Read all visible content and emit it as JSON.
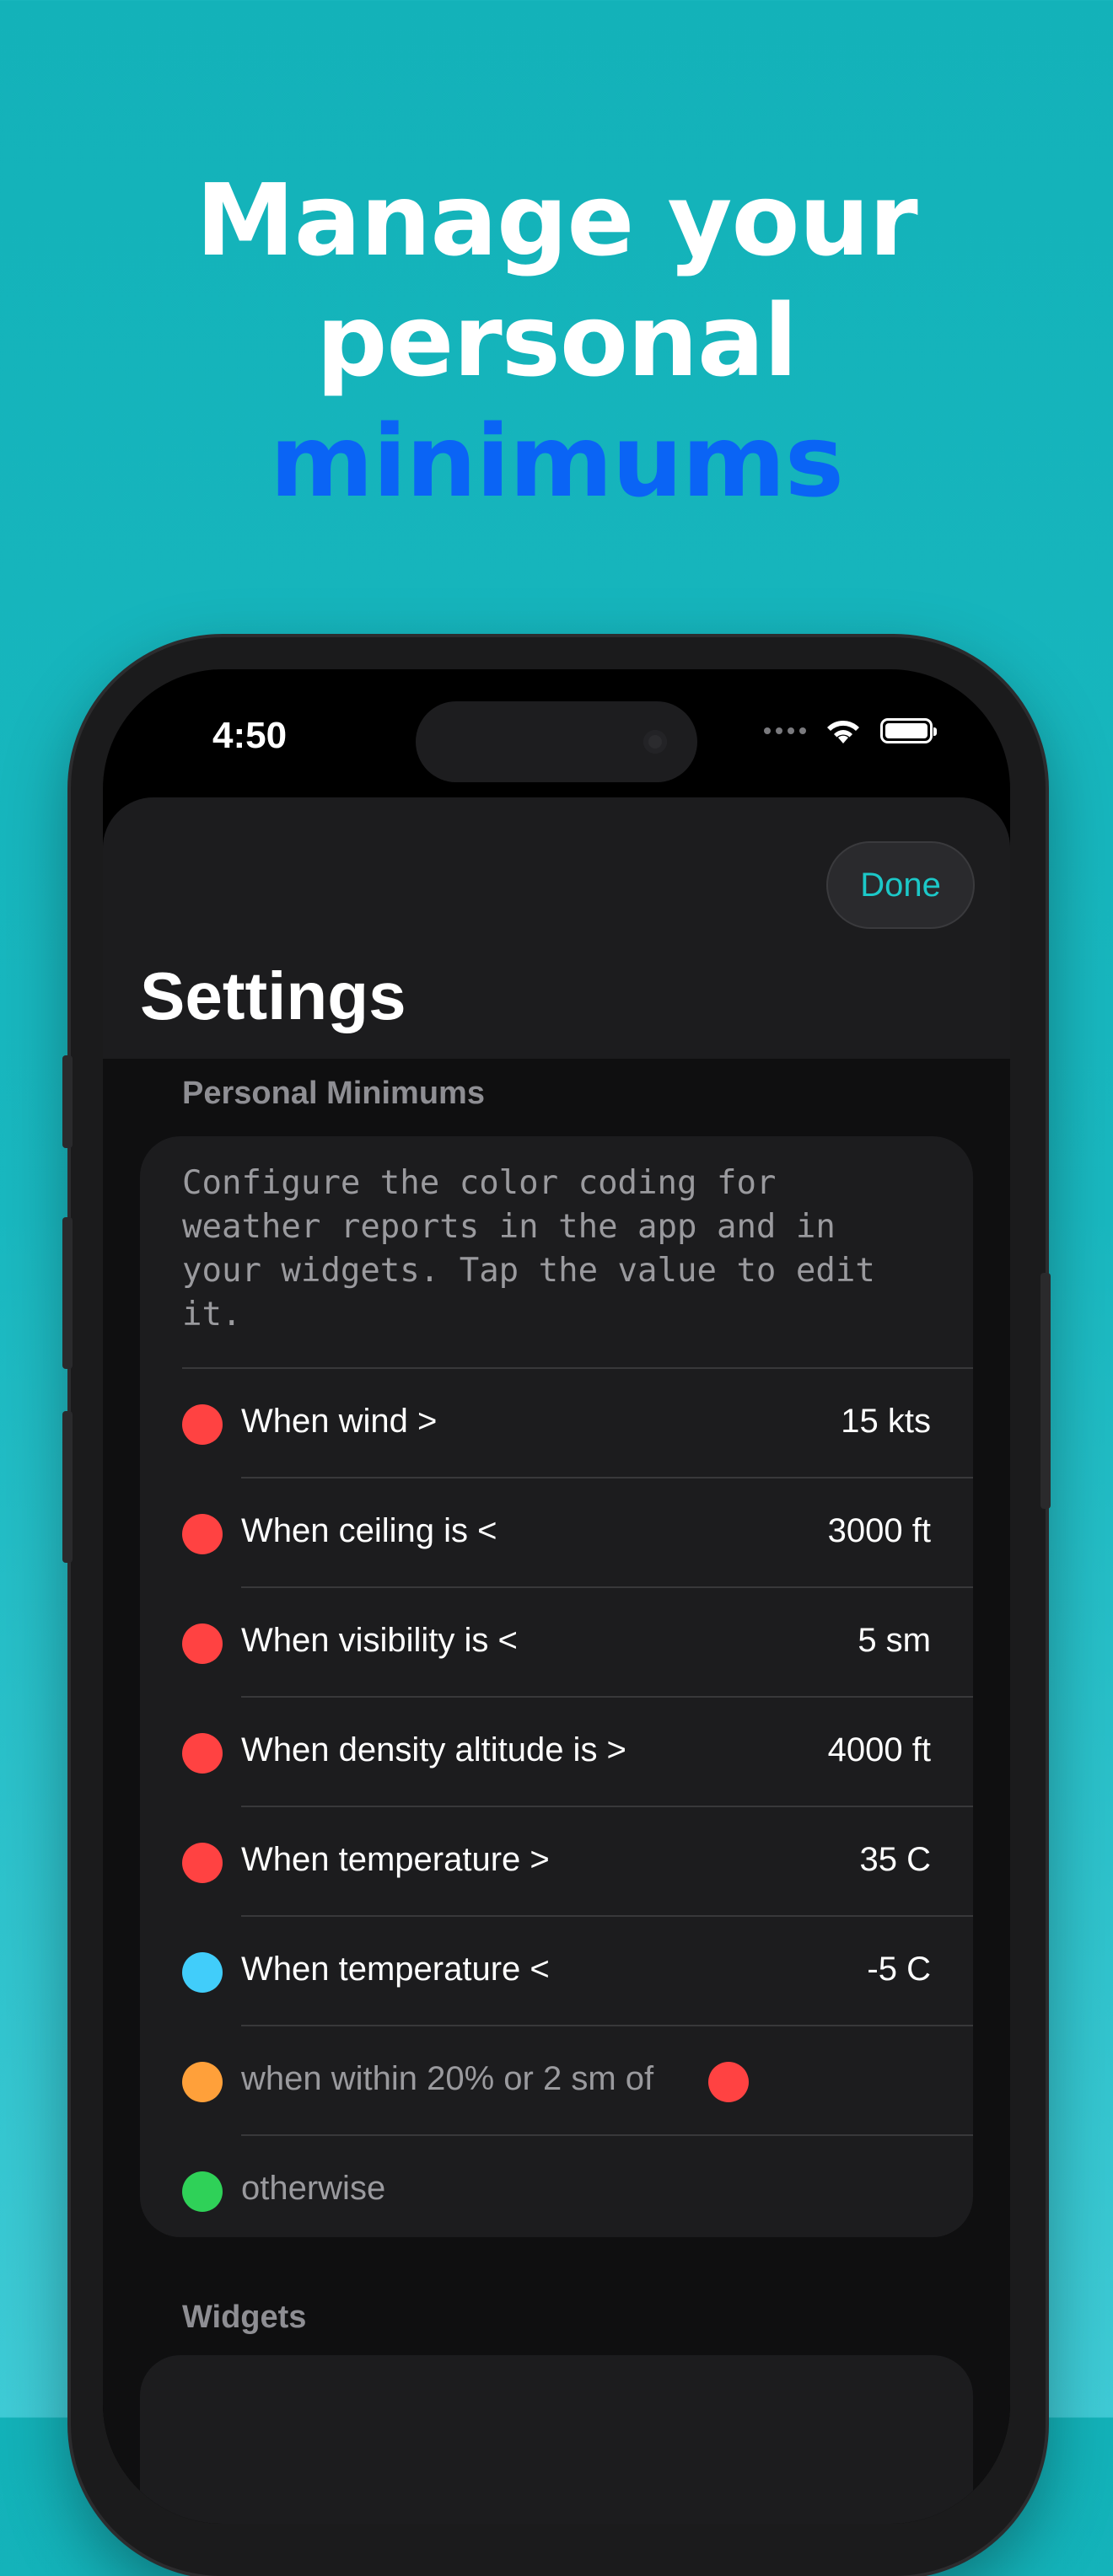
{
  "headline": {
    "line1": "Manage your",
    "line2": "personal",
    "line3": "minimums"
  },
  "colors": {
    "red": "#ff4242",
    "blue": "#41cdfa",
    "orange": "#ffa03a",
    "green": "#2fd158",
    "accent": "#1cc8c8",
    "headline_accent": "#0a64f5"
  },
  "status_bar": {
    "time": "4:50",
    "icons": [
      "cellular-dots-icon",
      "wifi-icon",
      "battery-icon"
    ]
  },
  "settings": {
    "done_label": "Done",
    "title": "Settings",
    "personal_minimums": {
      "header": "Personal Minimums",
      "description": "Configure the color coding for\nweather reports in the app and in\nyour widgets. Tap the value to edit\nit.",
      "rows": [
        {
          "label": "When wind >",
          "value": "15  kts",
          "dot": "red"
        },
        {
          "label": "When ceiling is <",
          "value": "3000  ft",
          "dot": "red"
        },
        {
          "label": "When visibility is <",
          "value": "5  sm",
          "dot": "red"
        },
        {
          "label": "When density altitude is >",
          "value": "4000  ft",
          "dot": "red"
        },
        {
          "label": "When temperature >",
          "value": "35  C",
          "dot": "red"
        },
        {
          "label": "When temperature <",
          "value": "-5  C",
          "dot": "blue"
        },
        {
          "label": "when within 20% or 2 sm of",
          "value": "",
          "dot": "orange"
        },
        {
          "label": "otherwise",
          "value": "",
          "dot": "green"
        }
      ]
    },
    "widgets_header": "Widgets"
  }
}
